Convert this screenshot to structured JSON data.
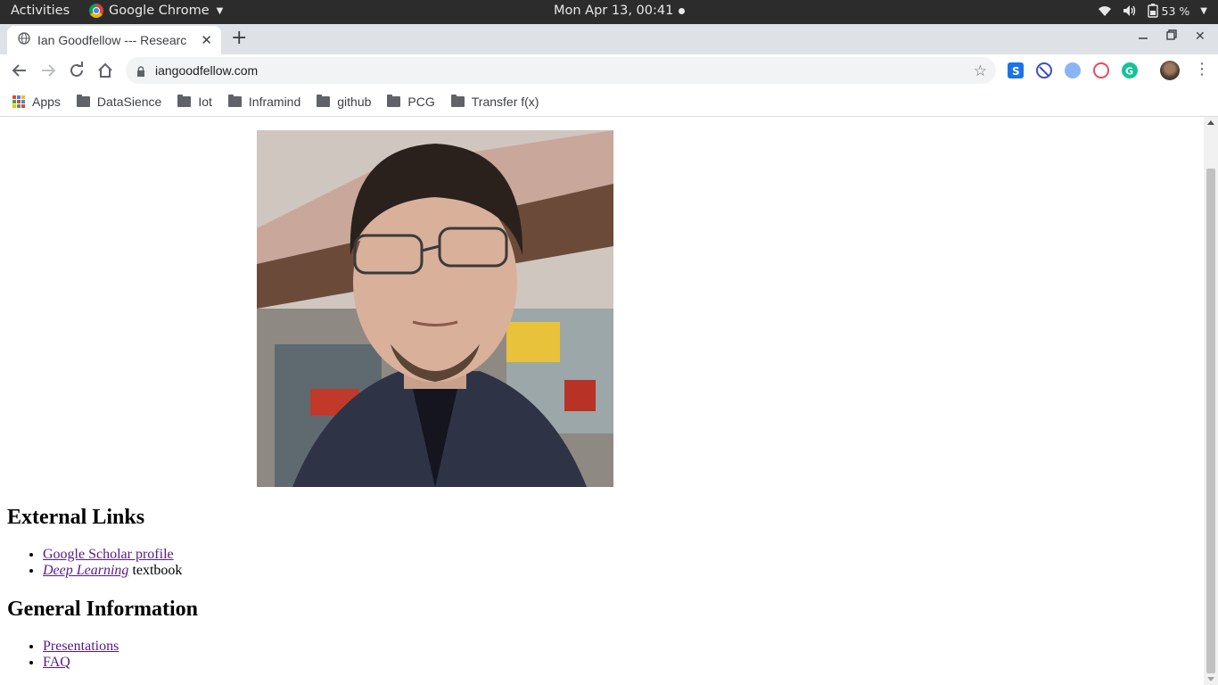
{
  "topbar": {
    "activities": "Activities",
    "app_name": "Google Chrome",
    "clock": "Mon Apr 13, 00:41",
    "battery": "53 %"
  },
  "browser": {
    "tab_title": "Ian Goodfellow --- Researc",
    "url": "iangoodfellow.com",
    "bookmarks": [
      "Apps",
      "DataSience",
      "Iot",
      "Inframind",
      "github",
      "PCG",
      "Transfer f(x)"
    ],
    "extensions": [
      {
        "name": "s-extension-icon",
        "color": "#1a73e8"
      },
      {
        "name": "blocker-extension-icon",
        "color": "#3f51b5"
      },
      {
        "name": "feather-extension-icon",
        "color": "#5b8def"
      },
      {
        "name": "spiral-extension-icon",
        "color": "#e84a5f"
      },
      {
        "name": "grammarly-extension-icon",
        "color": "#15c39a"
      }
    ]
  },
  "page": {
    "photo_alt": "",
    "external_links": {
      "heading": "External Links",
      "scholar_link": "Google Scholar profile",
      "dl_link": "Deep Learning",
      "dl_suffix": " textbook"
    },
    "general_info": {
      "heading": "General Information",
      "presentations": "Presentations",
      "faq": "FAQ"
    }
  },
  "colors": {
    "visited_link": "#551a8b",
    "topbar_bg": "#2c2c2c",
    "tabstrip_bg": "#dee1e6"
  }
}
